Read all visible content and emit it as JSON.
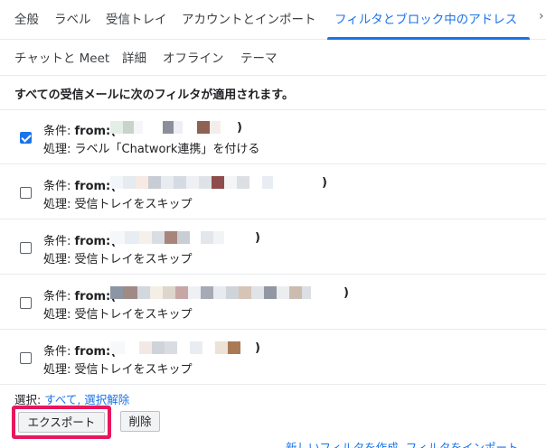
{
  "tabs_row1": [
    {
      "label": "全般",
      "active": false
    },
    {
      "label": "ラベル",
      "active": false
    },
    {
      "label": "受信トレイ",
      "active": false
    },
    {
      "label": "アカウントとインポート",
      "active": false
    },
    {
      "label": "フィルタとブロック中のアドレス",
      "active": true
    }
  ],
  "tabs_row2": [
    {
      "label": "チャットと Meet"
    },
    {
      "label": "詳細"
    },
    {
      "label": "オフライン"
    },
    {
      "label": "テーマ"
    }
  ],
  "section_title": "すべての受信メールに次のフィルタが適用されます。",
  "filters": [
    {
      "checked": true,
      "cond_prefix": "条件: ",
      "from_label": "from:(",
      "close_paren": ")",
      "action": "処理: ラベル「Chatwork連携」を付ける"
    },
    {
      "checked": false,
      "cond_prefix": "条件: ",
      "from_label": "from:(",
      "close_paren": ")",
      "action": "処理: 受信トレイをスキップ"
    },
    {
      "checked": false,
      "cond_prefix": "条件: ",
      "from_label": "from:(",
      "close_paren": ")",
      "action": "処理: 受信トレイをスキップ"
    },
    {
      "checked": false,
      "cond_prefix": "条件: ",
      "from_label": "from:(",
      "close_paren": ")",
      "action": "処理: 受信トレイをスキップ"
    },
    {
      "checked": false,
      "cond_prefix": "条件: ",
      "from_label": "from:(",
      "close_paren": ")",
      "action": "処理: 受信トレイをスキップ"
    }
  ],
  "selection": {
    "prefix": "選択: ",
    "all": "すべて",
    "separator": ", ",
    "none": "選択解除"
  },
  "buttons": {
    "export": "エクスポート",
    "delete": "削除"
  },
  "bottom_links": {
    "create": "新しいフィルタを作成",
    "import": "フィルタをインポート"
  },
  "colors": {
    "accent": "#1a73e8",
    "highlight_border": "#e8175d"
  },
  "icons": {
    "more_tabs": "chevron-right-icon"
  }
}
